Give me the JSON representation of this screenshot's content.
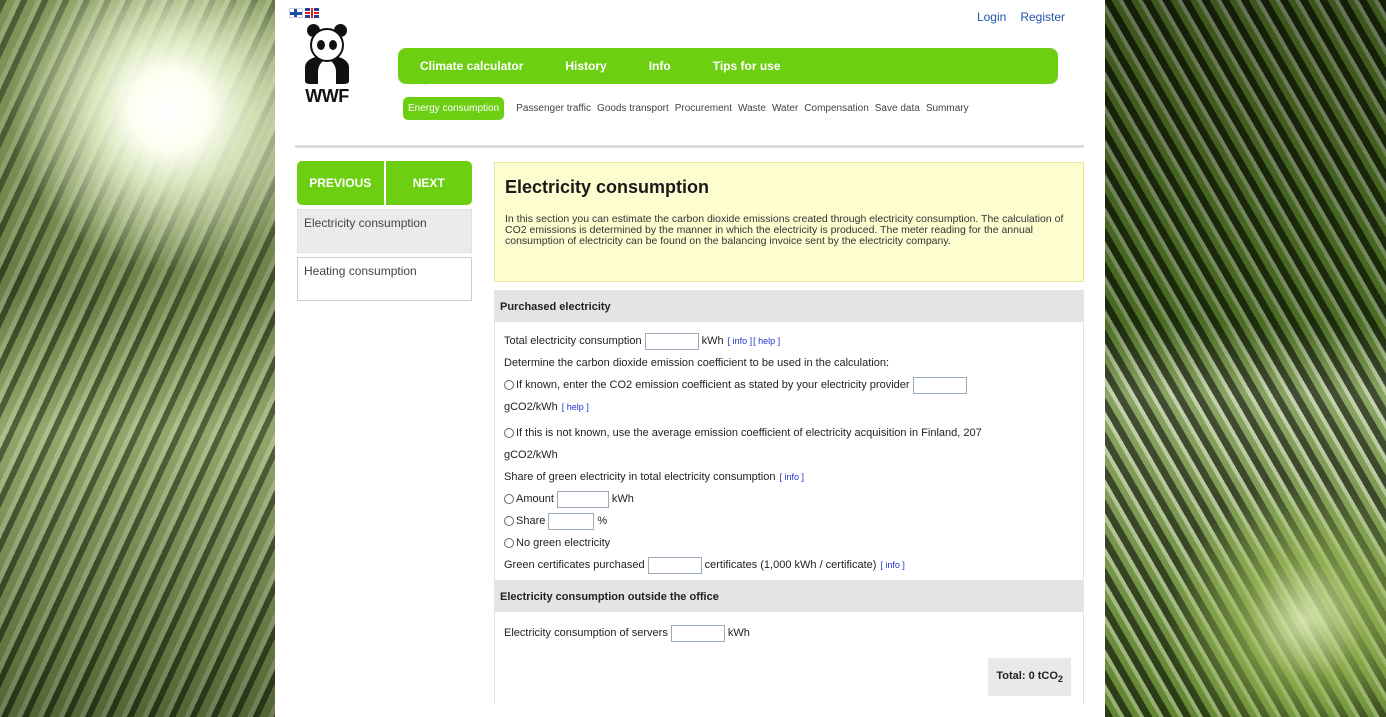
{
  "languages": [
    "fi",
    "en"
  ],
  "top_links": {
    "login": "Login",
    "register": "Register"
  },
  "logo": {
    "text": "WWF"
  },
  "main_nav": [
    {
      "label": "Climate calculator",
      "active": true
    },
    {
      "label": "History",
      "active": false
    },
    {
      "label": "Info",
      "active": false
    },
    {
      "label": "Tips for use",
      "active": false
    }
  ],
  "sub_nav": [
    {
      "label": "Energy consumption",
      "active": true
    },
    {
      "label": "Passenger traffic",
      "active": false
    },
    {
      "label": "Goods transport",
      "active": false
    },
    {
      "label": "Procurement",
      "active": false
    },
    {
      "label": "Waste",
      "active": false
    },
    {
      "label": "Water",
      "active": false
    },
    {
      "label": "Compensation",
      "active": false
    },
    {
      "label": "Save data",
      "active": false
    },
    {
      "label": "Summary",
      "active": false
    }
  ],
  "sidebar": {
    "previous": "PREVIOUS",
    "next": "NEXT",
    "items": [
      {
        "label": "Electricity consumption",
        "active": true
      },
      {
        "label": "Heating consumption",
        "active": false
      }
    ]
  },
  "intro": {
    "title": "Electricity consumption",
    "text": "In this section you can estimate the carbon dioxide emissions created through electricity consumption. The calculation of CO2 emissions is determined by the manner in which the electricity is produced. The meter reading for the annual consumption of electricity can be found on the balancing invoice sent by the electricity company."
  },
  "purchased": {
    "heading": "Purchased electricity",
    "total_label": "Total electricity consumption",
    "total_value": "",
    "unit_kwh": "kWh",
    "info": "[ info ]",
    "help": "[ help ]",
    "determine": "Determine the carbon dioxide emission coefficient to be used in the calculation:",
    "opt_known": "If known, enter the CO2 emission coefficient as stated by your electricity provider",
    "opt_known_unit": "gCO2/kWh",
    "opt_unknown": "If this is not known, use the average emission coefficient of electricity acquisition in Finland, 207",
    "opt_unknown_unit": "gCO2/kWh",
    "green_share_label": "Share of green electricity in total electricity consumption",
    "opt_amount": "Amount",
    "opt_share": "Share",
    "percent": "%",
    "opt_none": "No green electricity",
    "certs_label": "Green certificates purchased",
    "certs_unit": "certificates (1,000 kWh / certificate)"
  },
  "outside": {
    "heading": "Electricity consumption outside the office",
    "servers_label": "Electricity consumption of servers",
    "servers_unit": "kWh",
    "total_label": "Total: 0 tCO",
    "total_sub": "2"
  }
}
